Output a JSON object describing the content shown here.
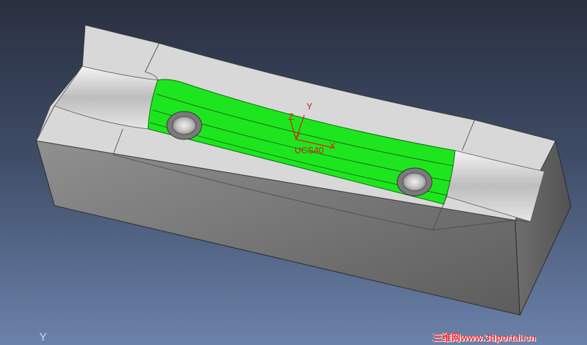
{
  "viewport": {
    "ucs_label": "UCS40",
    "axis_y_label": "Y",
    "axis_x_label": "X",
    "axis_z_label": "Z",
    "triad_y_label": "Y",
    "selected_face_color": "#1ee61e",
    "axis_color": "#e01818",
    "background_top": "#2a3040",
    "background_bottom": "#6b82aa"
  },
  "watermark": {
    "text": "三维网www.3dportal.cn"
  }
}
